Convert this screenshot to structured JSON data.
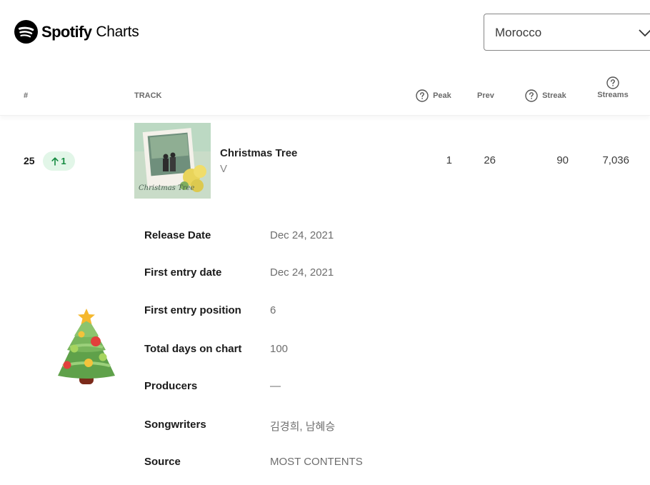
{
  "brand": {
    "name": "Spotify",
    "section": "Charts"
  },
  "country_select": {
    "value": "Morocco"
  },
  "table_header": {
    "rank": "#",
    "track": "TRACK",
    "peak": "Peak",
    "prev": "Prev",
    "streak": "Streak",
    "streams": "Streams"
  },
  "track_row": {
    "rank": "25",
    "movement": "1",
    "movement_direction": "up",
    "title": "Christmas Tree",
    "artist": "V",
    "peak": "1",
    "prev": "26",
    "streak": "90",
    "streams": "7,036"
  },
  "details": [
    {
      "label": "Release Date",
      "value": "Dec 24, 2021"
    },
    {
      "label": "First entry date",
      "value": "Dec 24, 2021"
    },
    {
      "label": "First entry position",
      "value": "6"
    },
    {
      "label": "Total days on chart",
      "value": "100"
    },
    {
      "label": "Producers",
      "value": "—"
    },
    {
      "label": "Songwriters",
      "value": "김경희, 남혜승"
    },
    {
      "label": "Source",
      "value": "MOST CONTENTS"
    }
  ],
  "colors": {
    "accent_green": "#1db954",
    "badge_bg": "#e2f6e8",
    "badge_text": "#138a3f"
  },
  "icons": [
    "spotify-logo-icon",
    "chevron-down-icon",
    "question-icon",
    "arrow-up-icon",
    "christmas-tree-icon"
  ]
}
